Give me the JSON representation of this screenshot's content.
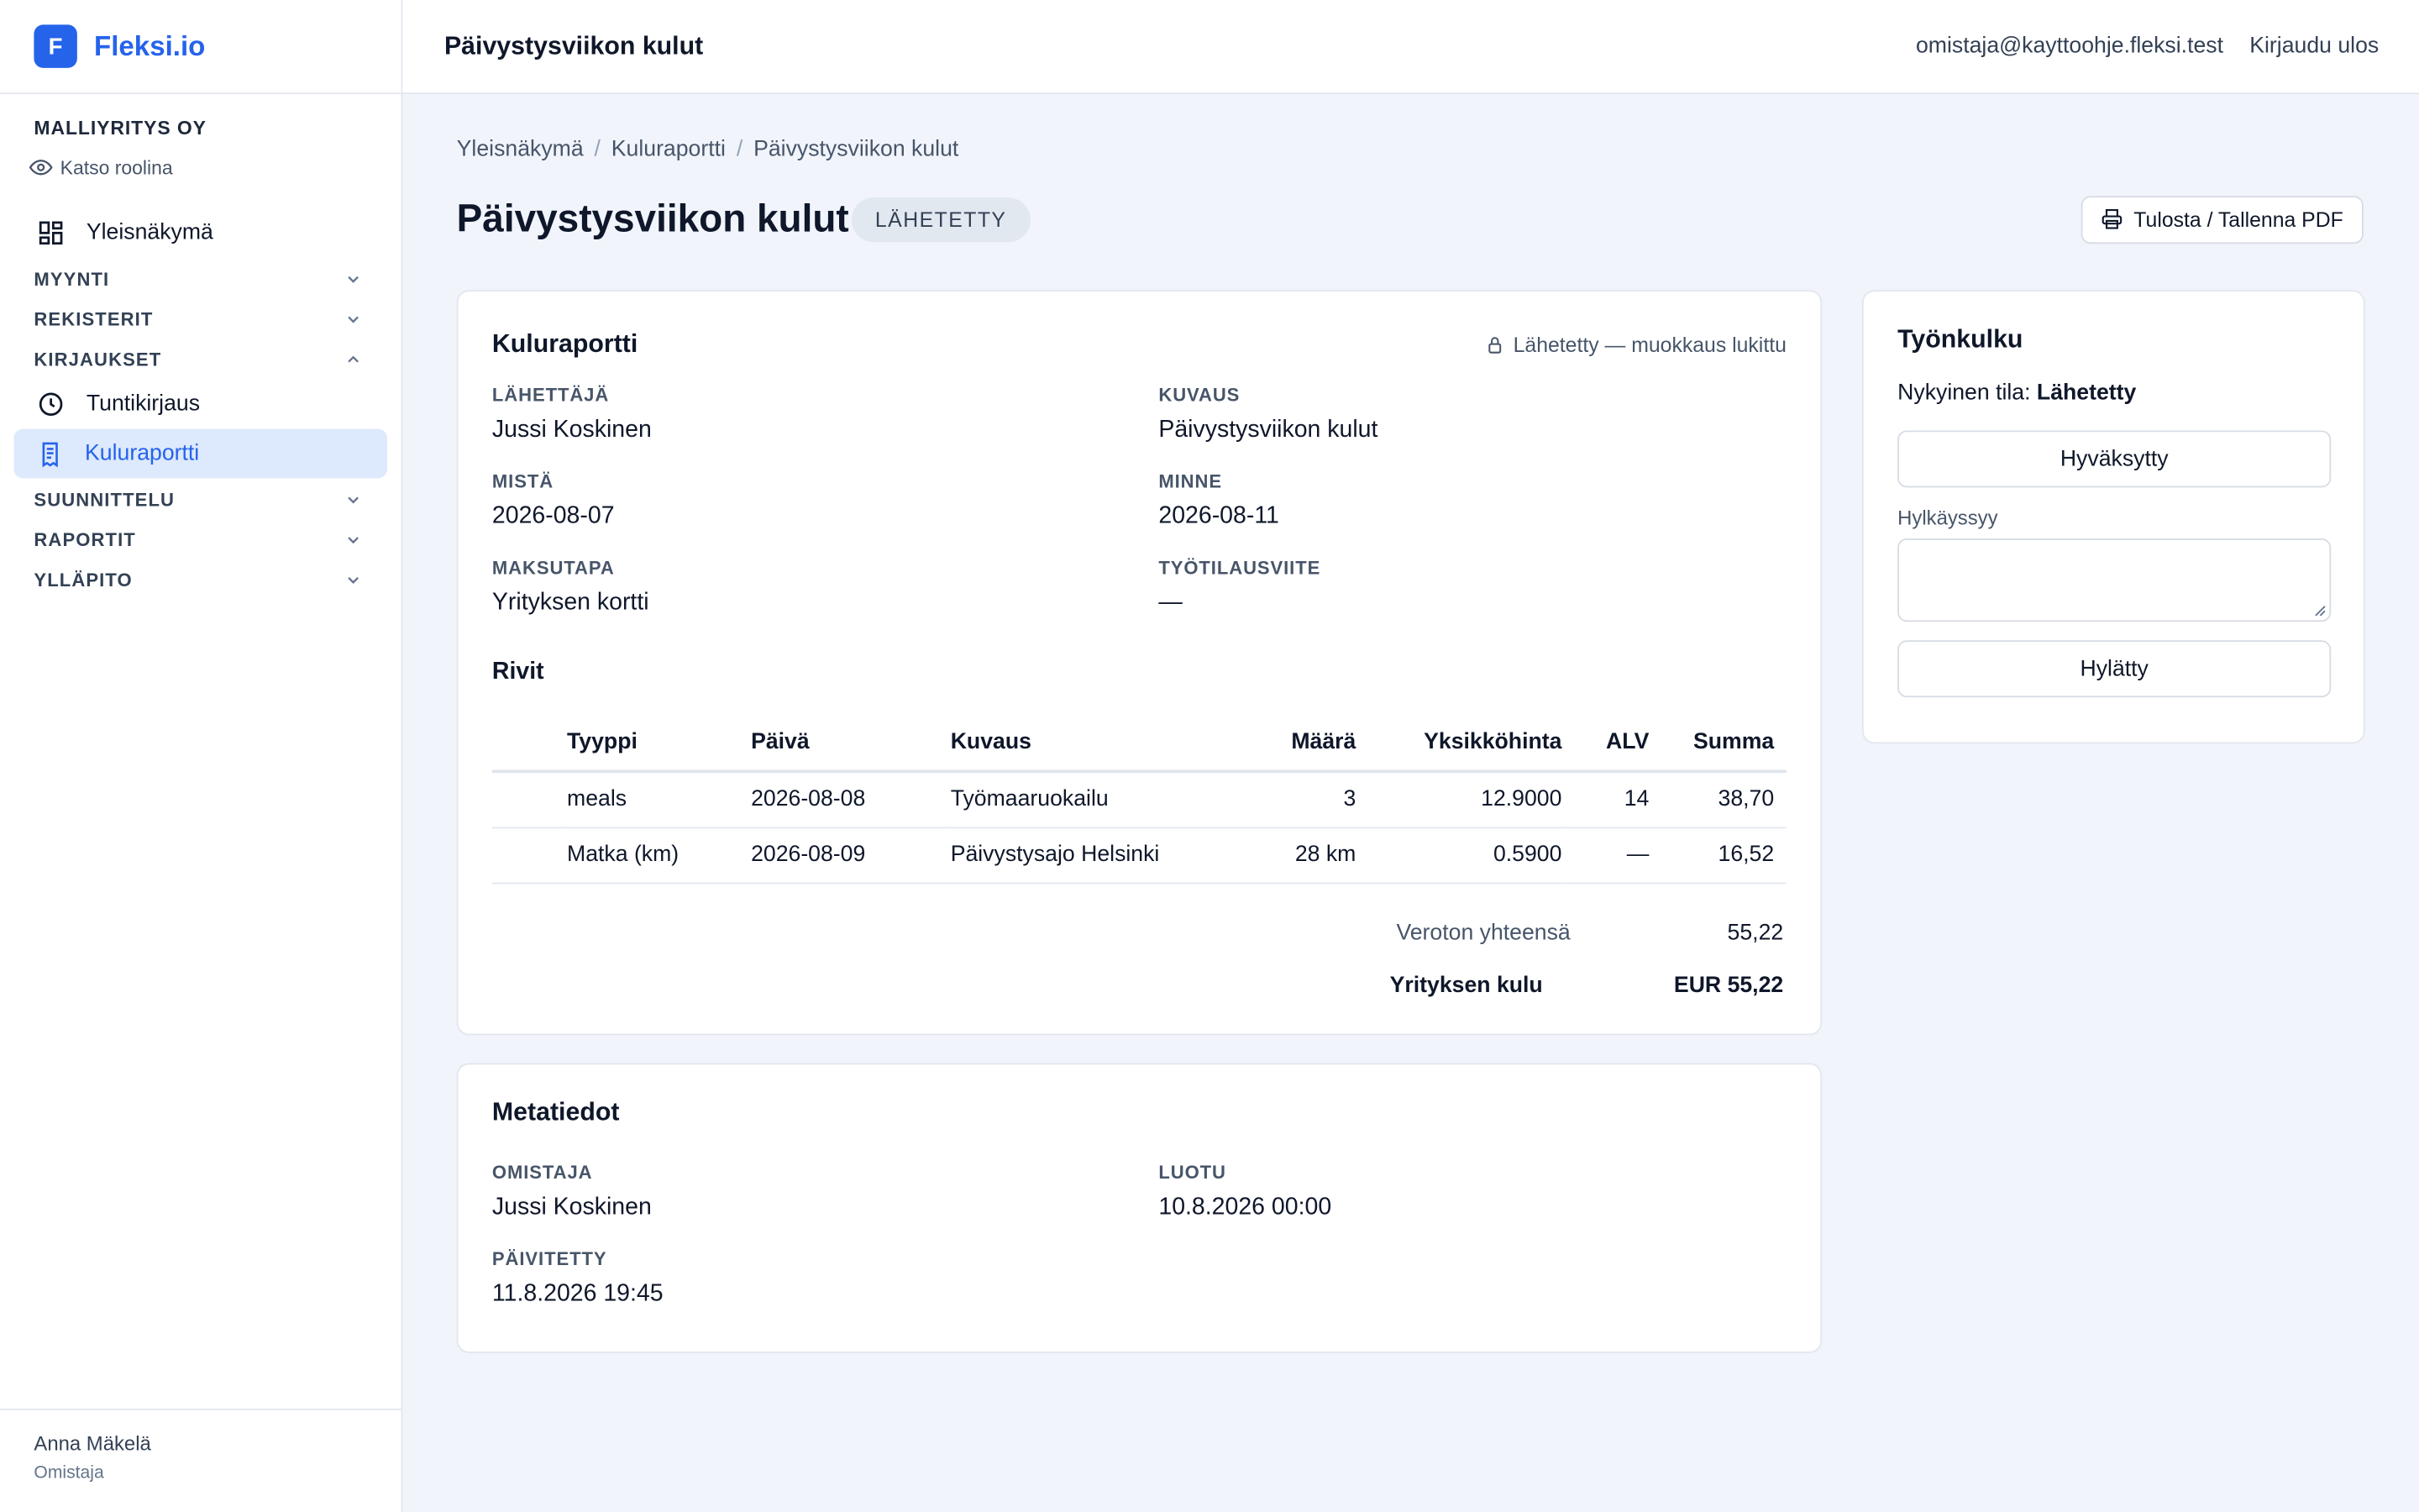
{
  "brand": {
    "logo_letter": "F",
    "name": "Fleksi.io"
  },
  "company": {
    "name": "MALLIYRITYS OY",
    "view_role": "Katso roolina"
  },
  "nav": {
    "overview": "Yleisnäkymä",
    "groups": {
      "sales": "MYYNTI",
      "registers": "REKISTERIT",
      "entries": "KIRJAUKSET",
      "planning": "SUUNNITTELU",
      "reports": "RAPORTIT",
      "admin": "YLLÄPITO"
    },
    "entries_items": [
      "Tuntikirjaus",
      "Kuluraportti"
    ]
  },
  "user": {
    "name": "Anna Mäkelä",
    "role": "Omistaja"
  },
  "topbar": {
    "title": "Päivystysviikon kulut",
    "email": "omistaja@kayttoohje.fleksi.test",
    "logout": "Kirjaudu ulos"
  },
  "breadcrumb": [
    "Yleisnäkymä",
    "Kuluraportti",
    "Päivystysviikon kulut"
  ],
  "page": {
    "title": "Päivystysviikon kulut",
    "status": "LÄHETETTY",
    "print_button": "Tulosta / Tallenna PDF"
  },
  "report": {
    "title": "Kuluraportti",
    "locked_text": "Lähetetty — muokkaus lukittu",
    "fields": {
      "sender_label": "LÄHETTÄJÄ",
      "sender": "Jussi Koskinen",
      "description_label": "KUVAUS",
      "description": "Päivystysviikon kulut",
      "from_label": "MISTÄ",
      "from": "2026-08-07",
      "to_label": "MINNE",
      "to": "2026-08-11",
      "payment_label": "MAKSUTAPA",
      "payment": "Yrityksen kortti",
      "work_order_label": "TYÖTILAUSVIITE",
      "work_order": "—"
    },
    "rows_title": "Rivit",
    "columns": [
      "Tyyppi",
      "Päivä",
      "Kuvaus",
      "Määrä",
      "Yksikköhinta",
      "ALV",
      "Summa"
    ],
    "rows": [
      [
        "meals",
        "2026-08-08",
        "Työmaaruokailu",
        "3",
        "12.9000",
        "14",
        "38,70"
      ],
      [
        "Matka (km)",
        "2026-08-09",
        "Päivystysajo Helsinki",
        "28 km",
        "0.5900",
        "—",
        "16,52"
      ]
    ],
    "totals": {
      "net_label": "Veroton yhteensä",
      "net": "55,22",
      "company_cost_label": "Yrityksen kulu",
      "company_cost": "EUR 55,22"
    }
  },
  "meta": {
    "title": "Metatiedot",
    "owner_label": "OMISTAJA",
    "owner": "Jussi Koskinen",
    "created_label": "LUOTU",
    "created": "10.8.2026 00:00",
    "updated_label": "PÄIVITETTY",
    "updated": "11.8.2026 19:45"
  },
  "workflow": {
    "title": "Työnkulku",
    "current_prefix": "Nykyinen tila:",
    "current_state": "Lähetetty",
    "approve_button": "Hyväksytty",
    "reason_label": "Hylkäyssyy",
    "reason_value": "",
    "reject_button": "Hylätty"
  },
  "colors": {
    "accent": "#2563eb",
    "active_bg": "#dde9fc",
    "page_bg": "#f1f4fb"
  }
}
